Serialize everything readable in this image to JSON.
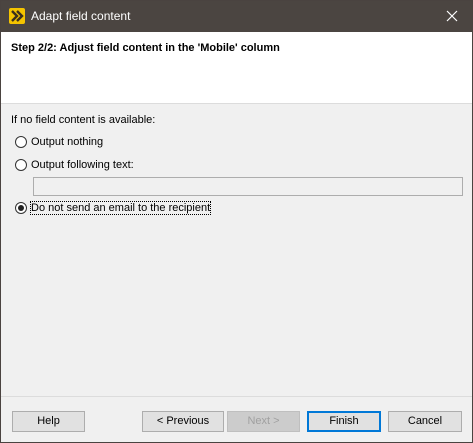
{
  "window": {
    "title": "Adapt field content",
    "close_icon": "close-icon",
    "app_icon": "app-logo-icon"
  },
  "header": {
    "step_title": "Step 2/2: Adjust field content in the 'Mobile' column"
  },
  "options": {
    "label": "If no field content is available:",
    "items": [
      {
        "label": "Output nothing",
        "checked": false
      },
      {
        "label": "Output following text:",
        "checked": false
      },
      {
        "label": "Do not send an email to the recipient",
        "checked": true
      }
    ],
    "text_value": "",
    "text_enabled": false
  },
  "buttons": {
    "help": "Help",
    "previous": "< Previous",
    "next": "Next >",
    "finish": "Finish",
    "cancel": "Cancel"
  },
  "colors": {
    "titlebar": "#4b4541",
    "accent": "#0078d7",
    "app_icon": "#f5c400"
  }
}
